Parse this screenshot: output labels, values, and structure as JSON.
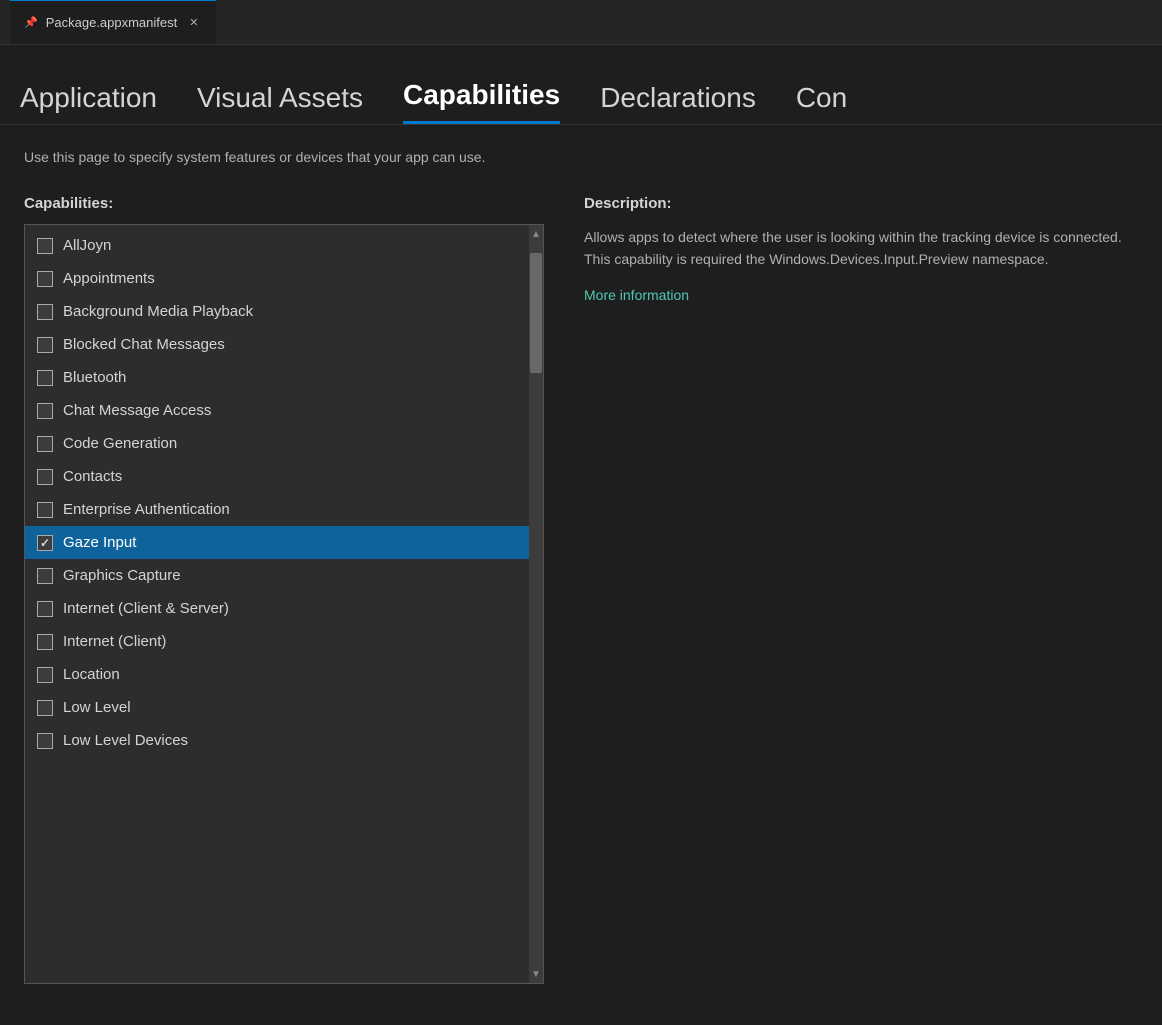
{
  "titleBar": {
    "tabLabel": "Package.appxmanifest",
    "pinIcon": "📌",
    "closeIcon": "✕"
  },
  "navTabs": [
    {
      "id": "application",
      "label": "Application",
      "active": false
    },
    {
      "id": "visual-assets",
      "label": "Visual Assets",
      "active": false
    },
    {
      "id": "capabilities",
      "label": "Capabilities",
      "active": true
    },
    {
      "id": "declarations",
      "label": "Declarations",
      "active": false
    },
    {
      "id": "con",
      "label": "Con",
      "active": false
    }
  ],
  "pageDescription": "Use this page to specify system features or devices that your app can use.",
  "capabilitiesLabel": "Capabilities:",
  "descriptionLabel": "Description:",
  "descriptionText": "Allows apps to detect where the user is looking within the tracking device is connected. This capability is required the Windows.Devices.Input.Preview namespace.",
  "moreInfoLabel": "More information",
  "capabilities": [
    {
      "id": "alljoyn",
      "label": "AllJoyn",
      "checked": false,
      "selected": false
    },
    {
      "id": "appointments",
      "label": "Appointments",
      "checked": false,
      "selected": false
    },
    {
      "id": "background-media-playback",
      "label": "Background Media Playback",
      "checked": false,
      "selected": false
    },
    {
      "id": "blocked-chat-messages",
      "label": "Blocked Chat Messages",
      "checked": false,
      "selected": false
    },
    {
      "id": "bluetooth",
      "label": "Bluetooth",
      "checked": false,
      "selected": false
    },
    {
      "id": "chat-message-access",
      "label": "Chat Message Access",
      "checked": false,
      "selected": false
    },
    {
      "id": "code-generation",
      "label": "Code Generation",
      "checked": false,
      "selected": false
    },
    {
      "id": "contacts",
      "label": "Contacts",
      "checked": false,
      "selected": false
    },
    {
      "id": "enterprise-authentication",
      "label": "Enterprise Authentication",
      "checked": false,
      "selected": false
    },
    {
      "id": "gaze-input",
      "label": "Gaze Input",
      "checked": true,
      "selected": true
    },
    {
      "id": "graphics-capture",
      "label": "Graphics Capture",
      "checked": false,
      "selected": false
    },
    {
      "id": "internet-client-server",
      "label": "Internet (Client & Server)",
      "checked": false,
      "selected": false
    },
    {
      "id": "internet-client",
      "label": "Internet (Client)",
      "checked": false,
      "selected": false
    },
    {
      "id": "location",
      "label": "Location",
      "checked": false,
      "selected": false
    },
    {
      "id": "low-level",
      "label": "Low Level",
      "checked": false,
      "selected": false
    },
    {
      "id": "low-level-devices",
      "label": "Low Level Devices",
      "checked": false,
      "selected": false
    }
  ]
}
